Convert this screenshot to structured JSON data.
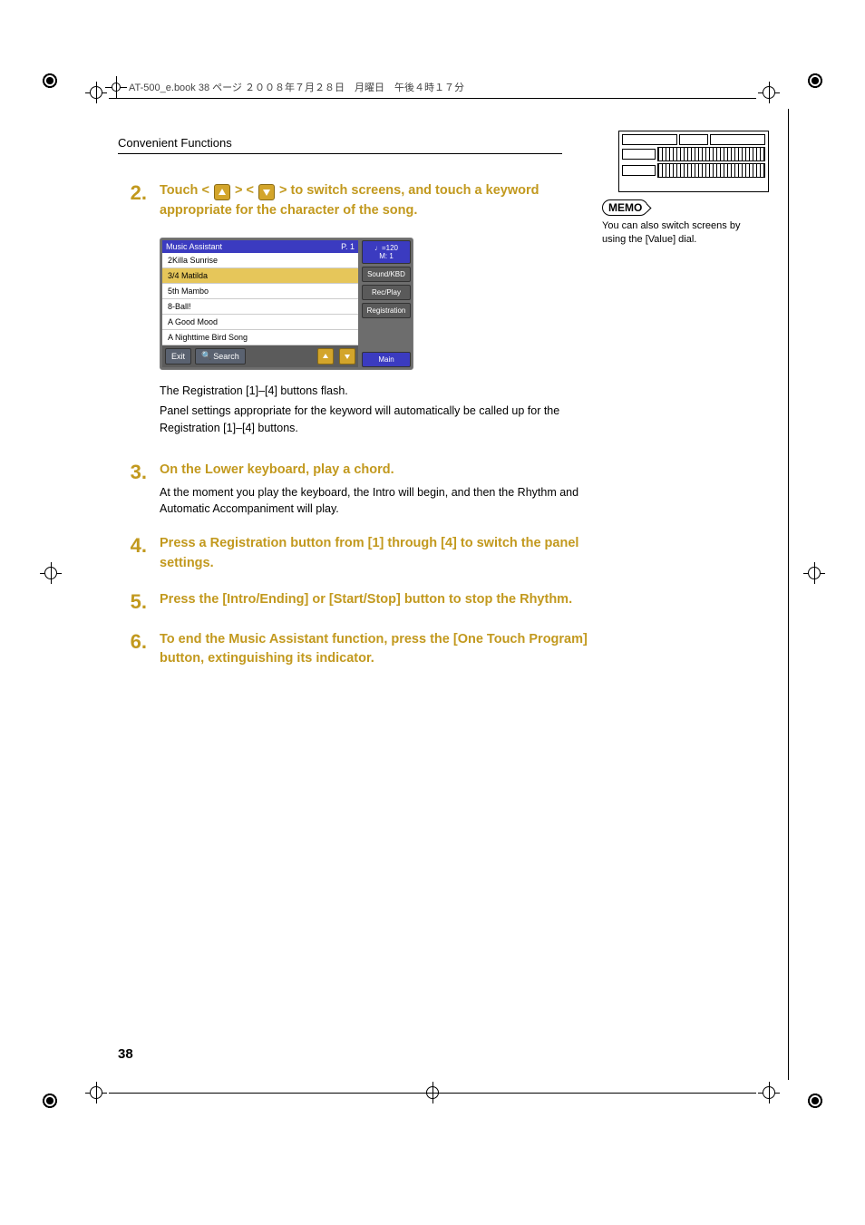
{
  "header_text": "AT-500_e.book 38 ページ ２００８年７月２８日　月曜日　午後４時１７分",
  "section_title": "Convenient Functions",
  "page_number": "38",
  "steps": {
    "s2": {
      "num": "2.",
      "head_pre": "Touch <",
      "head_mid1": "> <",
      "head_post": "> to switch screens, and touch a keyword appropriate for the character of the song.",
      "para1": "The Registration [1]–[4] buttons flash.",
      "para2": "Panel settings appropriate for the keyword will automatically be called up for the Registration [1]–[4] buttons."
    },
    "s3": {
      "num": "3.",
      "head": "On the Lower keyboard, play a chord.",
      "para": "At the moment you play the keyboard, the Intro will begin, and then the Rhythm and Automatic Accompaniment will play."
    },
    "s4": {
      "num": "4.",
      "head": "Press a Registration button from [1] through [4] to switch the panel settings."
    },
    "s5": {
      "num": "5.",
      "head": "Press the [Intro/Ending] or [Start/Stop] button to stop the Rhythm."
    },
    "s6": {
      "num": "6.",
      "head": "To end the Music Assistant function, press the [One Touch Program] button, extinguishing its indicator."
    }
  },
  "screenshot": {
    "title": "Music Assistant",
    "page_indicator": "P. 1",
    "items": [
      "2Killa Sunrise",
      "3/4 Matilda",
      "5th Mambo",
      "8-Ball!",
      "A Good Mood",
      "A Nighttime Bird Song"
    ],
    "selected_index": 1,
    "exit": "Exit",
    "search": "Search",
    "tempo": "♩=120",
    "measure": "M:   1",
    "tabs": [
      "Sound/KBD",
      "Rec/Play",
      "Registration",
      "Main"
    ]
  },
  "memo": {
    "label": "MEMO",
    "text": "You can also switch screens by using the [Value] dial."
  }
}
